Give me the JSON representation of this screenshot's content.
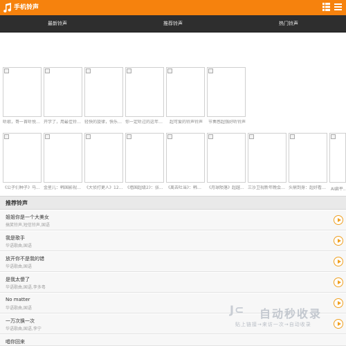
{
  "header": {
    "site_title": "手机铃声",
    "logo_icon": "music-note-icon",
    "grid_icon": "grid-menu-icon",
    "list_icon": "list-menu-icon",
    "accent": "#f6820d"
  },
  "nav": {
    "items": [
      {
        "label": "最新铃声"
      },
      {
        "label": "推荐铃声"
      },
      {
        "label": "热门铃声"
      }
    ]
  },
  "gallery_row1": [
    {
      "caption": "听歌，哥一首听悦明..."
    },
    {
      "caption": "开学了，用最佳铃声..."
    },
    {
      "caption": "轻快的旋律，快乐的..."
    },
    {
      "caption": "你一定听过的这年最..."
    },
    {
      "caption": "超可爱的铃声铃声"
    },
    {
      "caption": "节奏感超强好听铃声"
    }
  ],
  "gallery_row2": [
    {
      "caption": "《公子们种子》马..."
    },
    {
      "caption": "金星儿：韩国影视文..."
    },
    {
      "caption": "《大侦打更人》12月..."
    },
    {
      "caption": "《墙国超级2》：张..."
    },
    {
      "caption": "《离去吐当》：韩西..."
    },
    {
      "caption": "《月球陨落》超越..."
    },
    {
      "caption": "三沙卫视新年晚会开..."
    },
    {
      "caption": "头鼎到身：超好看马..."
    },
    {
      "caption": "AI扁平..."
    }
  ],
  "recommended": {
    "title": "推荐铃声",
    "songs": [
      {
        "title": "姐姐你是一个大美女",
        "meta": "搞笑铃声,短信铃声,国语"
      },
      {
        "title": "我是歌手",
        "meta": "华语歌曲,国语"
      },
      {
        "title": "放开你不是我的错",
        "meta": "华语歌曲,国语"
      },
      {
        "title": "是我太傻了",
        "meta": "华语歌曲,国语,李多粤"
      },
      {
        "title": "No matter",
        "meta": "华语歌曲,国语"
      },
      {
        "title": "一万次换一次",
        "meta": "华语歌曲,国语,李宁"
      },
      {
        "title": "唱你回来",
        "meta": ""
      }
    ]
  },
  "watermark": {
    "logo": "J⊂",
    "text": "自动秒收录",
    "sub": "贴上链接→来访一次→自动收录"
  }
}
